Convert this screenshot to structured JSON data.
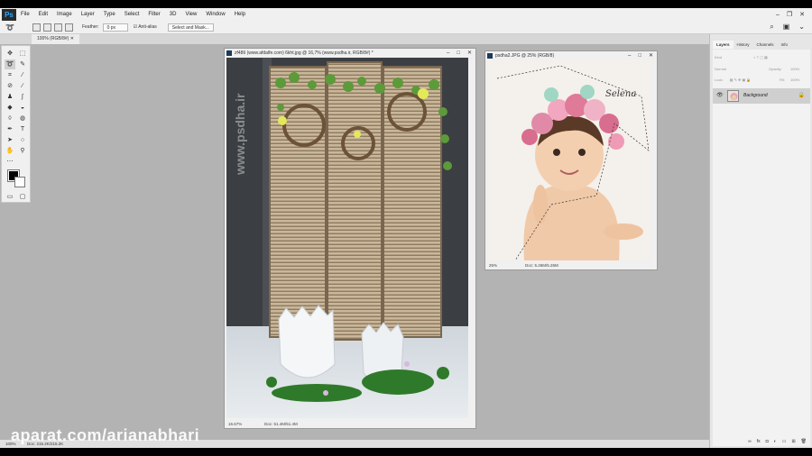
{
  "app": {
    "logo": "Ps"
  },
  "menu": [
    "File",
    "Edit",
    "Image",
    "Layer",
    "Type",
    "Select",
    "Filter",
    "3D",
    "View",
    "Window",
    "Help"
  ],
  "window_controls": [
    "–",
    "❐",
    "✕"
  ],
  "options": {
    "feather_label": "Feather:",
    "feather_value": "0 px",
    "antialias_label": "Anti-alias",
    "select_mask": "Select and Mask..."
  },
  "doc_tab": "100% (RGB/8#)",
  "doc1": {
    "title": "zf486 (www.afdalfe.com) 6kht.jpg @ 16,7% (www.psdha.ir, RGB/8#) *",
    "zoom": "16.67%",
    "docsize": "Doc: 51.4M/51.4M",
    "photo_watermark": "www.psdha.ir"
  },
  "doc2": {
    "title": "psdha2.JPG @ 25% (RGB/8)",
    "zoom": "25%",
    "docsize": "Doc: 5.26M/5.26M",
    "signature": "Selena"
  },
  "panels": {
    "tabs": [
      "Layers",
      "History",
      "Channels",
      "Info"
    ],
    "kind": "Kind",
    "blend": "Normal",
    "opacity_label": "Opacity:",
    "opacity_value": "100%",
    "lock_label": "Lock:",
    "fill_label": "Fill:",
    "fill_value": "100%",
    "layer_name": "Background"
  },
  "status": {
    "zoom": "100%",
    "docsize": "Doc: 215.2K/215.2K"
  },
  "video_watermark": "aparat.com/arianabhari",
  "colors": {
    "accent": "#31a8ff",
    "foreground": "#000000",
    "background": "#ffffff"
  }
}
